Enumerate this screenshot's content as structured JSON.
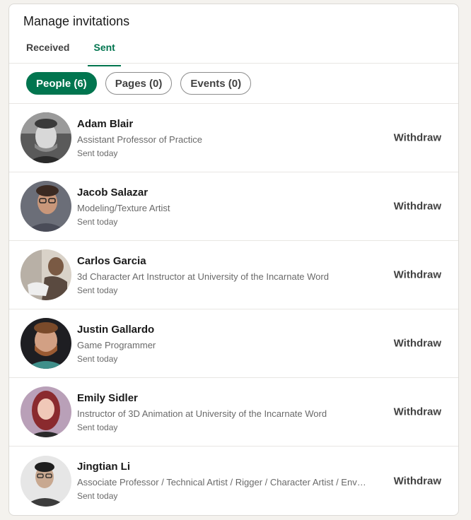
{
  "header": {
    "title": "Manage invitations",
    "tabs": [
      {
        "label": "Received",
        "active": false
      },
      {
        "label": "Sent",
        "active": true
      }
    ]
  },
  "filters": [
    {
      "label": "People (6)",
      "active": true
    },
    {
      "label": "Pages (0)",
      "active": false
    },
    {
      "label": "Events (0)",
      "active": false
    }
  ],
  "invitations": [
    {
      "name": "Adam Blair",
      "headline": "Assistant Professor of Practice",
      "sent": "Sent today",
      "action": "Withdraw"
    },
    {
      "name": "Jacob Salazar",
      "headline": "Modeling/Texture Artist",
      "sent": "Sent today",
      "action": "Withdraw"
    },
    {
      "name": "Carlos Garcia",
      "headline": "3d Character Art Instructor at University of the Incarnate Word",
      "sent": "Sent today",
      "action": "Withdraw"
    },
    {
      "name": "Justin Gallardo",
      "headline": "Game Programmer",
      "sent": "Sent today",
      "action": "Withdraw"
    },
    {
      "name": "Emily Sidler",
      "headline": "Instructor of 3D Animation at University of the Incarnate Word",
      "sent": "Sent today",
      "action": "Withdraw"
    },
    {
      "name": "Jingtian Li",
      "headline": "Associate Professor / Technical Artist / Rigger / Character Artist / Environment Artist",
      "sent": "Sent today",
      "action": "Withdraw"
    }
  ],
  "colors": {
    "accent": "#01754f",
    "background": "#f4f2ee"
  }
}
